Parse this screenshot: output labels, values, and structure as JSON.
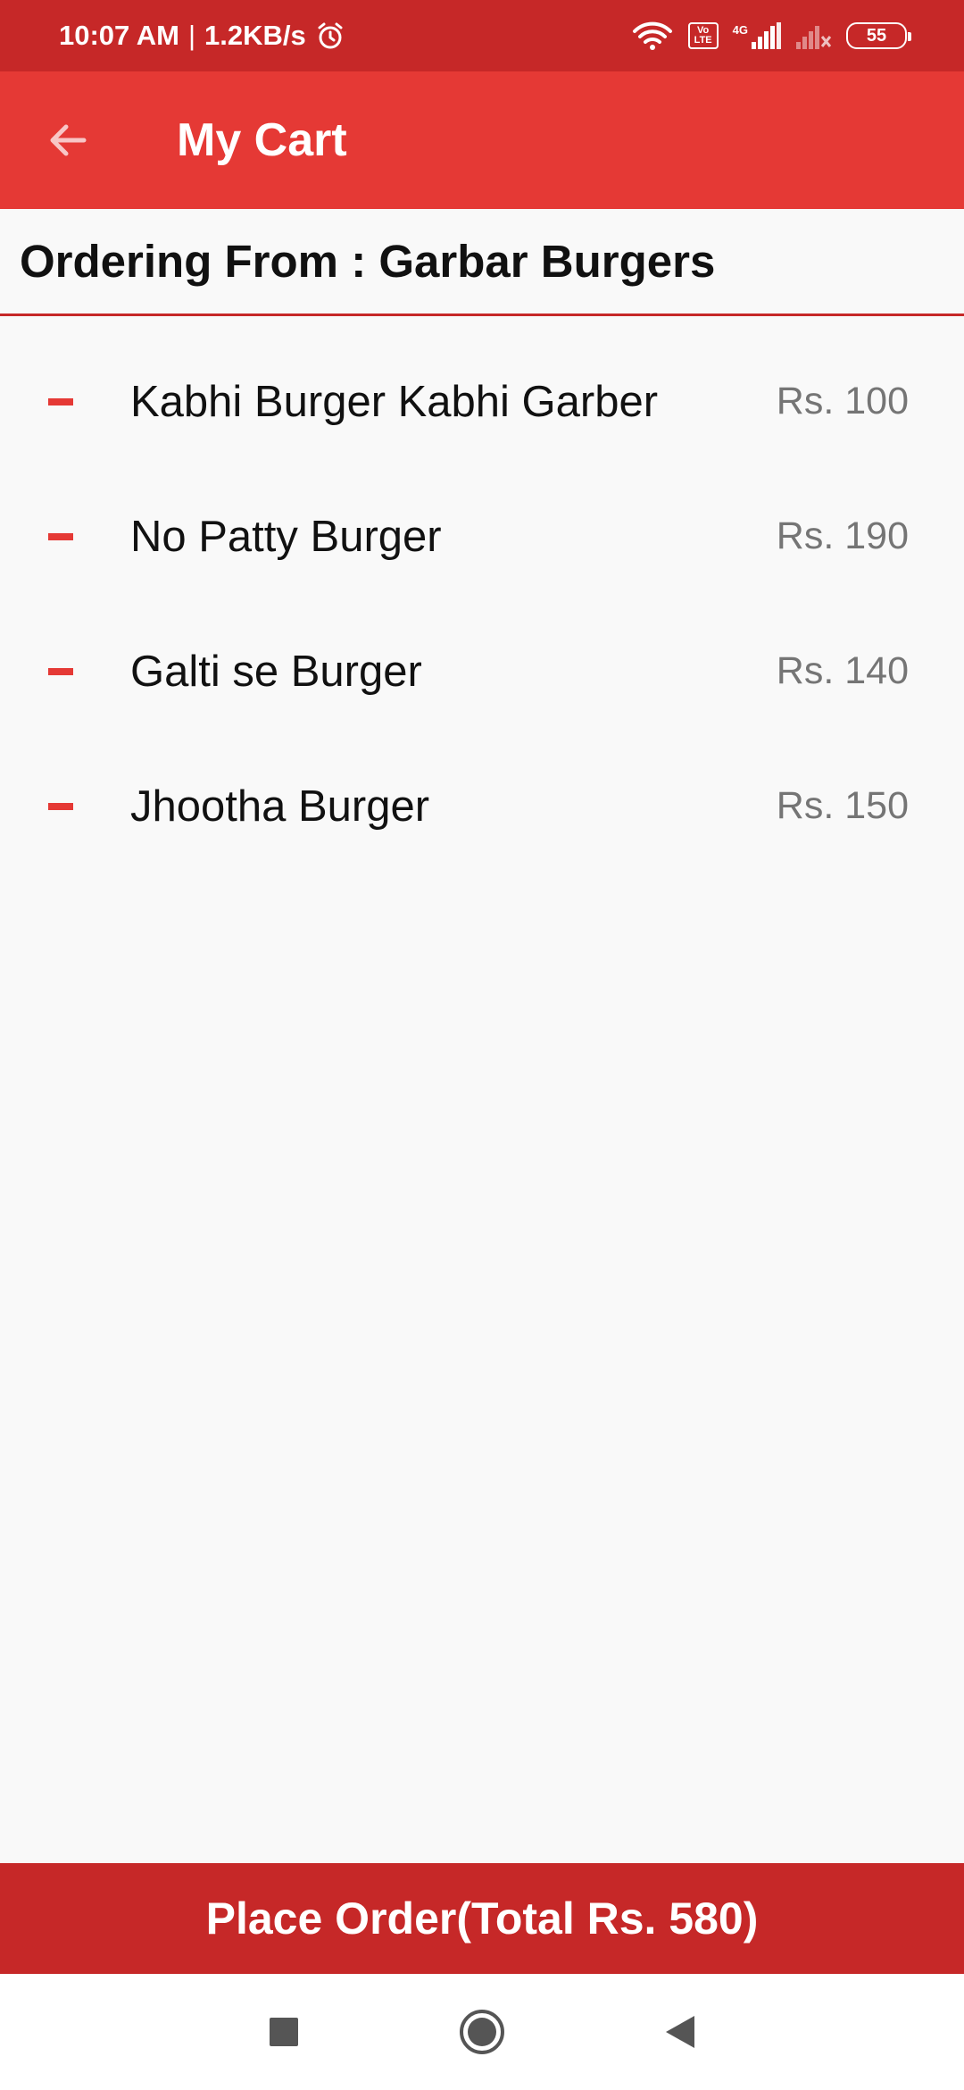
{
  "status_bar": {
    "time": "10:07 AM",
    "separator": "|",
    "net_speed": "1.2KB/s",
    "volte_line1": "Vo",
    "volte_line2": "LTE",
    "network_type": "4G",
    "battery": "55",
    "icons": [
      "alarm-icon",
      "wifi-icon",
      "volte-icon",
      "signal-icon",
      "no-signal-icon",
      "battery-icon"
    ]
  },
  "app_bar": {
    "title": "My Cart",
    "back_icon": "arrow-left-icon"
  },
  "order": {
    "ordering_from": "Ordering From : Garbar Burgers"
  },
  "cart": {
    "items": [
      {
        "name": "Kabhi Burger Kabhi Garber",
        "price": "Rs. 100"
      },
      {
        "name": "No Patty Burger",
        "price": "Rs. 190"
      },
      {
        "name": "Galti se Burger",
        "price": "Rs. 140"
      },
      {
        "name": "Jhootha Burger",
        "price": "Rs. 150"
      }
    ]
  },
  "footer": {
    "place_order_label": "Place Order(Total Rs. 580)"
  },
  "nav_bar": {
    "icons": [
      "recents-square-icon",
      "home-circle-icon",
      "back-triangle-icon"
    ]
  },
  "colors": {
    "status_bar": "#c62828",
    "app_bar": "#e53935",
    "accent": "#e53935",
    "place_order": "#c62828",
    "price_text": "#757575"
  }
}
